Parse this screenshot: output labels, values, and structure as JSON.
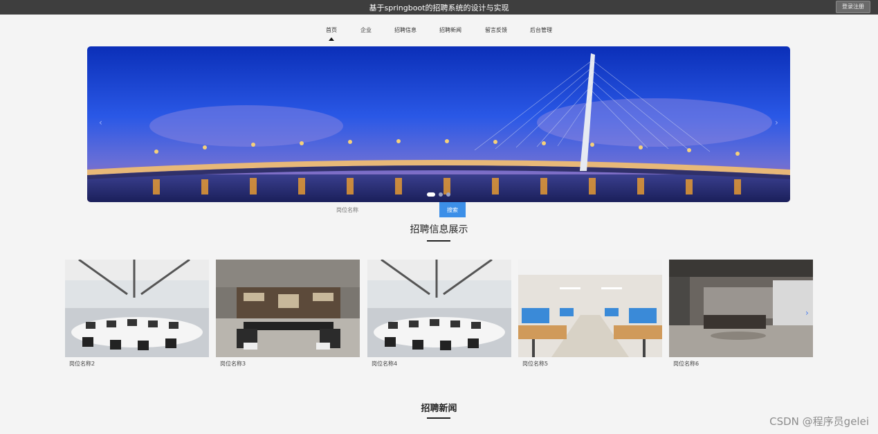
{
  "header": {
    "title": "基于springboot的招聘系统的设计与实现",
    "login_label": "登录注册"
  },
  "nav": {
    "items": [
      {
        "label": "首页"
      },
      {
        "label": "企业"
      },
      {
        "label": "招聘信息"
      },
      {
        "label": "招聘新闻"
      },
      {
        "label": "留言反馈"
      },
      {
        "label": "后台管理"
      }
    ],
    "active_index": 0
  },
  "carousel": {
    "slide_count": 3,
    "active_slide": 0,
    "prev_icon": "chevron-left-icon",
    "next_icon": "chevron-right-icon"
  },
  "search": {
    "placeholder": "岗位名称",
    "button_label": "搜索"
  },
  "jobs_section": {
    "title": "招聘信息展示",
    "cards": [
      {
        "label": "岗位名称2"
      },
      {
        "label": "岗位名称3"
      },
      {
        "label": "岗位名称4"
      },
      {
        "label": "岗位名称5"
      },
      {
        "label": "岗位名称6"
      }
    ]
  },
  "news_section": {
    "title": "招聘新闻"
  },
  "watermark": {
    "text": "CSDN @程序员gelei"
  },
  "colors": {
    "topbar": "#3e3e3e",
    "accent": "#3c8fe8",
    "page_bg": "#f4f4f4"
  }
}
